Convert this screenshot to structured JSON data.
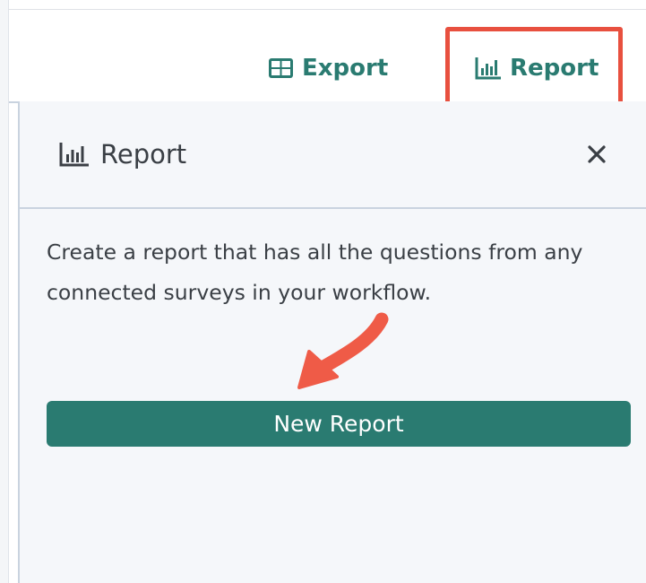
{
  "toolbar": {
    "export_label": "Export",
    "report_label": "Report",
    "export_icon": "table-grid-icon",
    "report_icon": "bar-chart-icon"
  },
  "panel": {
    "title": "Report",
    "title_icon": "bar-chart-icon",
    "close_icon": "close-icon",
    "description": "Create a report that has all the questions from any connected surveys in your workflow.",
    "new_report_label": "New Report"
  },
  "annotations": {
    "highlight_color": "#e8503f",
    "arrow_color": "#ef5b47"
  },
  "colors": {
    "accent": "#2a7b71",
    "panel_bg": "#f5f7fa",
    "border": "#c9d3df",
    "text": "#3a3f45"
  }
}
